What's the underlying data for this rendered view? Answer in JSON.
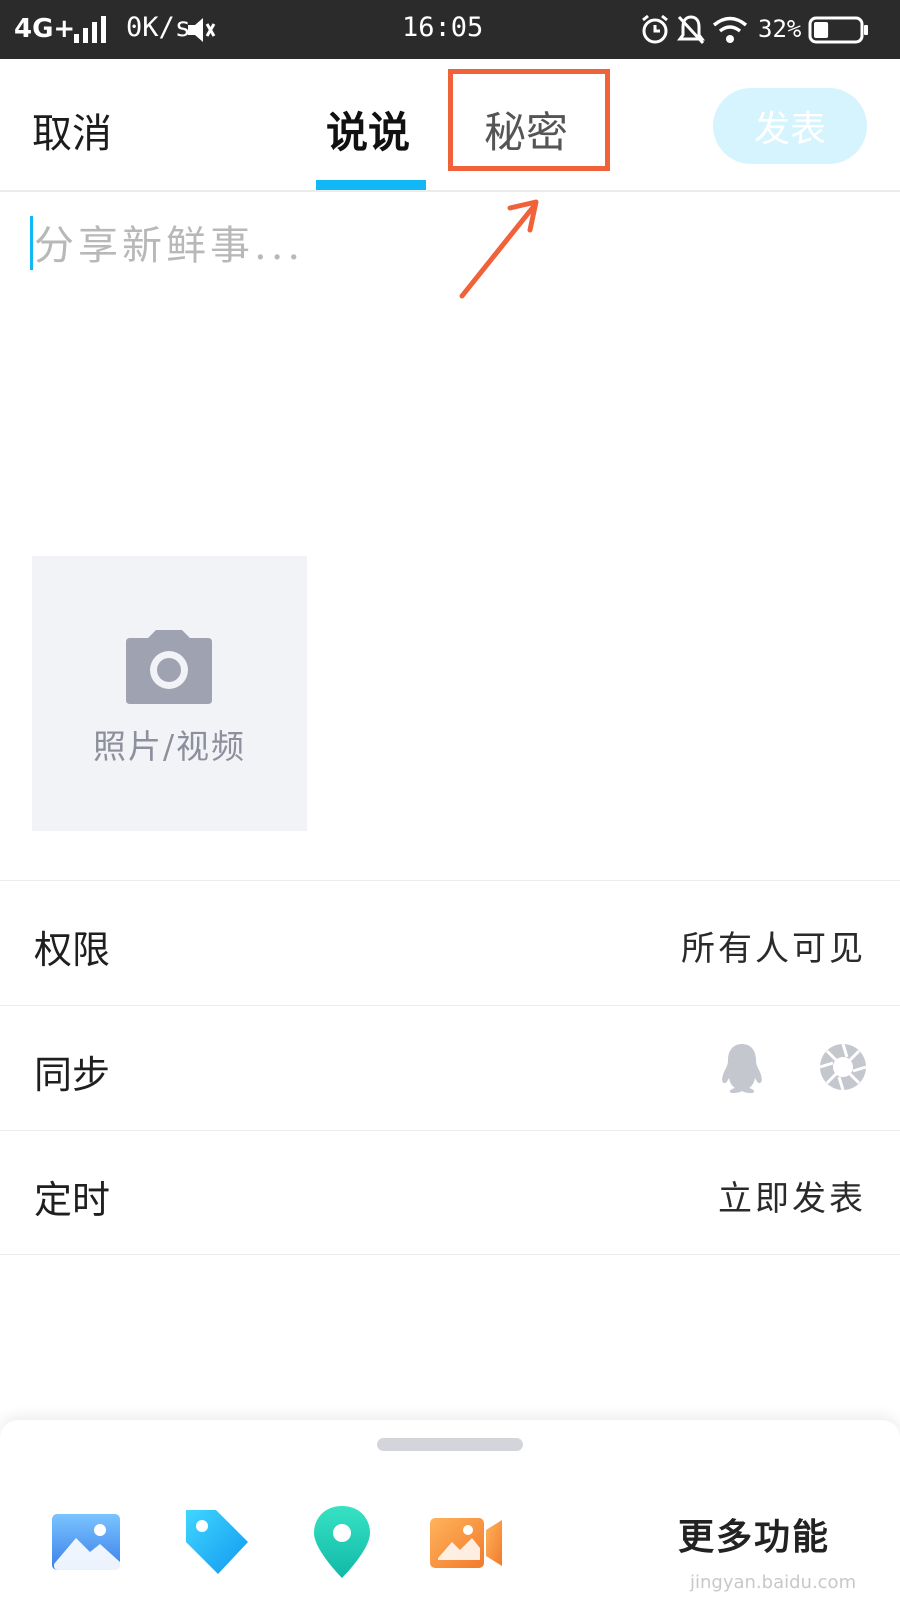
{
  "status_bar": {
    "network": "4G+",
    "speed": "0K/s",
    "time": "16:05",
    "battery": "32%",
    "battery_level": 0.32
  },
  "header": {
    "cancel_label": "取消",
    "tabs": [
      {
        "label": "说说",
        "active": true
      },
      {
        "label": "秘密",
        "active": false
      }
    ],
    "publish_label": "发表"
  },
  "compose": {
    "placeholder": "分享新鲜事..."
  },
  "media": {
    "label": "照片/视频"
  },
  "settings": {
    "permission": {
      "label": "权限",
      "value": "所有人可见"
    },
    "sync": {
      "label": "同步"
    },
    "schedule": {
      "label": "定时",
      "value": "立即发表"
    }
  },
  "toolbar": {
    "more_label": "更多功能"
  },
  "watermark": "jingyan.baidu.com",
  "colors": {
    "accent": "#12b7f5",
    "highlight": "#f0623a",
    "publish_disabled": "#d6f4fd"
  }
}
